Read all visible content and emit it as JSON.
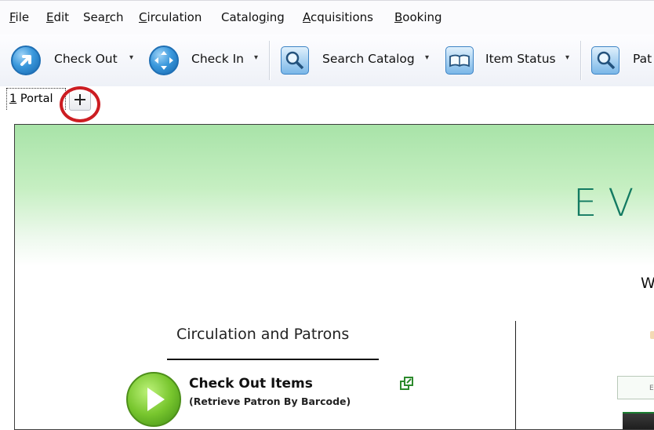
{
  "menubar": {
    "items": [
      {
        "key": "F",
        "rest": "ile"
      },
      {
        "key": "E",
        "rest": "dit"
      },
      {
        "pre": "Sea",
        "key": "r",
        "rest": "ch"
      },
      {
        "key": "C",
        "rest": "irculation"
      },
      {
        "pre": "Catalo",
        "key": "g",
        "rest": "ing"
      },
      {
        "key": "A",
        "rest": "cquisitions"
      },
      {
        "key": "B",
        "rest": "ooking"
      }
    ]
  },
  "toolbar": {
    "checkout_label": "Check Out",
    "checkin_label": "Check In",
    "search_label": "Search Catalog",
    "itemstatus_label": "Item Status",
    "patron_label": "Pat",
    "dropdown_glyph": "▾"
  },
  "tabs": {
    "portal_number": "1",
    "portal_label": " Portal",
    "add_glyph": "+"
  },
  "portal": {
    "brand_text": "EV",
    "welcome_text": "W",
    "circ_heading": "Circulation and Patrons",
    "checkout_title": "Check Out Items",
    "checkout_subtitle": "(Retrieve Patron By Barcode)",
    "right_box_text": "E"
  },
  "colors": {
    "highlight_circle": "#cc1d22",
    "banner_green": "#a8e3a8",
    "brand_text": "#137a62"
  }
}
